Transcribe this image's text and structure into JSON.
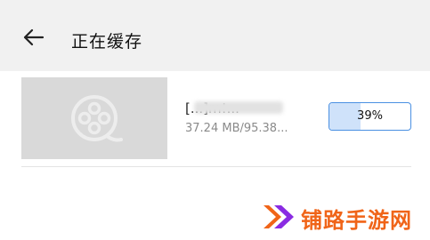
{
  "header": {
    "title": "正在缓存",
    "back_icon": "arrow-left-icon"
  },
  "download": {
    "name": "[...]m!...",
    "size": "37.24 MB/95.38...",
    "progress_label": "39%",
    "progress": 0.39,
    "thumbnail_icon": "film-reel-icon"
  },
  "watermark": {
    "text": "铺路手游网",
    "icon": "double-chevron-icon",
    "color": "#f06418"
  },
  "colors": {
    "header_bg": "#f1f1f1",
    "accent": "#4a90e2",
    "progress_fill": "#cfe2fa"
  }
}
